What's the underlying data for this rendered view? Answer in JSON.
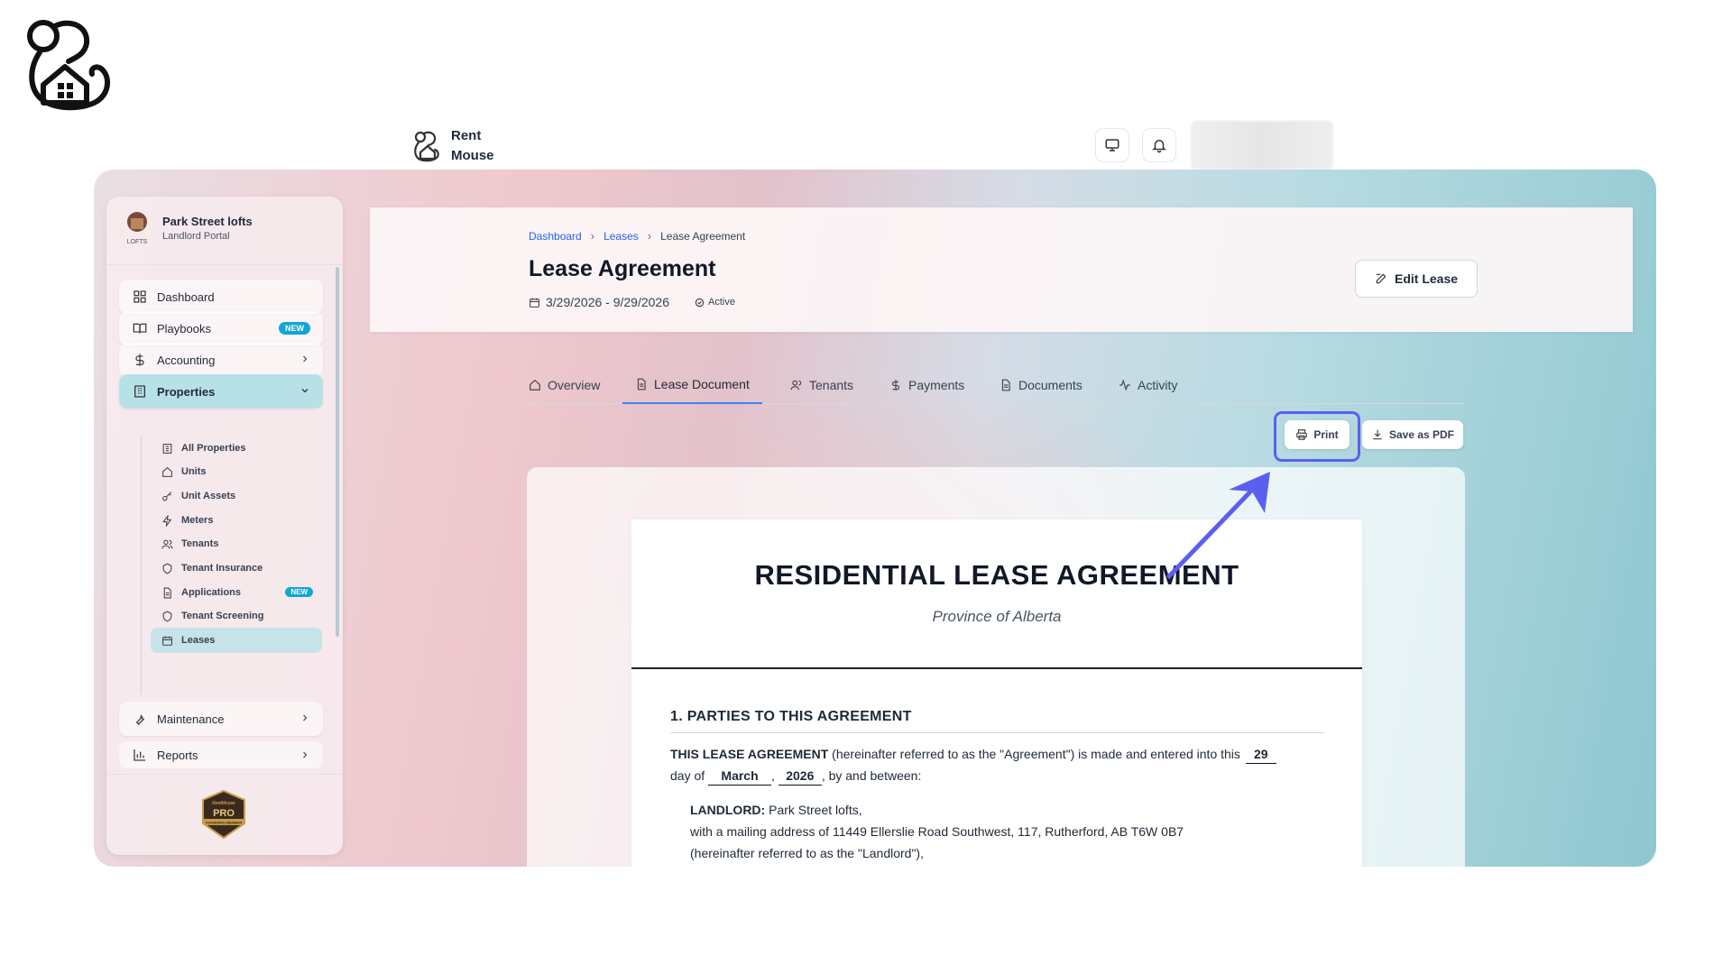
{
  "app": {
    "brand_name_line1": "Rent",
    "brand_name_line2": "Mouse"
  },
  "sidebar": {
    "org_name": "Park Street lofts",
    "org_role": "Landlord Portal",
    "avatar_text": "LOFTS",
    "new_badge": "NEW",
    "items": [
      {
        "label": "Dashboard",
        "icon": "grid-icon"
      },
      {
        "label": "Playbooks",
        "icon": "book-icon"
      },
      {
        "label": "Accounting",
        "icon": "dollar-icon"
      },
      {
        "label": "Properties",
        "icon": "building-icon"
      },
      {
        "label": "Maintenance",
        "icon": "wrench-icon"
      },
      {
        "label": "Reports",
        "icon": "bar-chart-icon"
      }
    ],
    "sub_items": [
      {
        "label": "All Properties",
        "icon": "building-icon"
      },
      {
        "label": "Units",
        "icon": "home-icon"
      },
      {
        "label": "Unit Assets",
        "icon": "key-icon"
      },
      {
        "label": "Meters",
        "icon": "bolt-icon"
      },
      {
        "label": "Tenants",
        "icon": "users-icon"
      },
      {
        "label": "Tenant Insurance",
        "icon": "shield-icon"
      },
      {
        "label": "Applications",
        "icon": "file-icon"
      },
      {
        "label": "Tenant Screening",
        "icon": "shield-icon"
      },
      {
        "label": "Leases",
        "icon": "calendar-icon"
      }
    ],
    "pro_badge": {
      "line1": "RentMouse",
      "line2": "PRO",
      "line3": "FOUNDING MEMBER"
    }
  },
  "header": {
    "breadcrumb": [
      "Dashboard",
      "Leases",
      "Lease Agreement"
    ],
    "title": "Lease Agreement",
    "date_range": "3/29/2026 - 9/29/2026",
    "status": "Active",
    "edit_label": "Edit Lease"
  },
  "tabs": [
    {
      "label": "Overview",
      "icon": "home-icon"
    },
    {
      "label": "Lease Document",
      "icon": "file-icon"
    },
    {
      "label": "Tenants",
      "icon": "users-icon"
    },
    {
      "label": "Payments",
      "icon": "dollar-icon"
    },
    {
      "label": "Documents",
      "icon": "file-icon"
    },
    {
      "label": "Activity",
      "icon": "activity-icon"
    }
  ],
  "active_tab": "Lease Document",
  "actions": {
    "print_label": "Print",
    "pdf_label": "Save as PDF"
  },
  "document": {
    "title": "RESIDENTIAL LEASE AGREEMENT",
    "subtitle": "Province of Alberta",
    "section1_heading": "1. PARTIES TO THIS AGREEMENT",
    "intro_bold": "THIS LEASE AGREEMENT",
    "intro_rest": "(hereinafter referred to as the \"Agreement\") is made and entered into this",
    "day": "29",
    "day_of": "day of",
    "month": "March",
    "comma": ",",
    "year": "2026",
    "between": ", by and between:",
    "landlord_label": "LANDLORD:",
    "landlord_name": "Park Street lofts,",
    "landlord_address": "with a mailing address of 11449 Ellerslie Road Southwest, 117, Rutherford, AB T6W 0B7",
    "landlord_ref": "(hereinafter referred to as the \"Landlord\"),"
  },
  "colors": {
    "accent": "#3b82f6",
    "highlight_outline": "#5b5ff0",
    "badge": "#12a6d6",
    "active_nav": "#b8e1e7"
  }
}
